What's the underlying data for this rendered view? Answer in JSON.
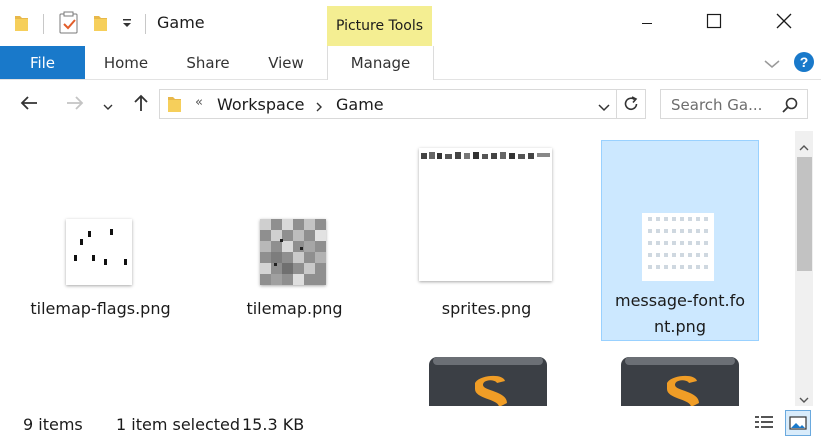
{
  "window": {
    "title": "Game",
    "contextual_tab_group": "Picture Tools"
  },
  "ribbon": {
    "tabs": [
      "File",
      "Home",
      "Share",
      "View",
      "Manage"
    ],
    "active_tab": "Manage"
  },
  "address_bar": {
    "overflow": "«",
    "breadcrumbs": [
      "Workspace",
      "Game"
    ]
  },
  "search": {
    "placeholder": "Search Ga..."
  },
  "files": [
    {
      "name": "tilemap-flags.png",
      "selected": false
    },
    {
      "name": "tilemap.png",
      "selected": false
    },
    {
      "name": "sprites.png",
      "selected": false
    },
    {
      "name": "message-font.png",
      "label_line1": "message-font.fo",
      "label_line2": "nt.png",
      "selected": true
    },
    {
      "name": "sublime-file-1",
      "selected": false
    },
    {
      "name": "sublime-file-2",
      "selected": false
    }
  ],
  "status": {
    "item_count": "9 items",
    "selection": "1 item selected",
    "size": "15.3 KB"
  },
  "colors": {
    "accent": "#1979ca",
    "picture_tools": "#f4ee92",
    "selection_bg": "#cce8ff",
    "selection_border": "#99d1ff"
  },
  "icons": {
    "quick_access": [
      "folder-icon",
      "properties-check-icon",
      "new-folder-icon",
      "customize-dropdown-icon"
    ],
    "window": [
      "minimize-icon",
      "maximize-icon",
      "close-icon"
    ],
    "navigation": [
      "back-arrow-icon",
      "forward-arrow-icon",
      "recent-dropdown-icon",
      "up-arrow-icon"
    ]
  }
}
